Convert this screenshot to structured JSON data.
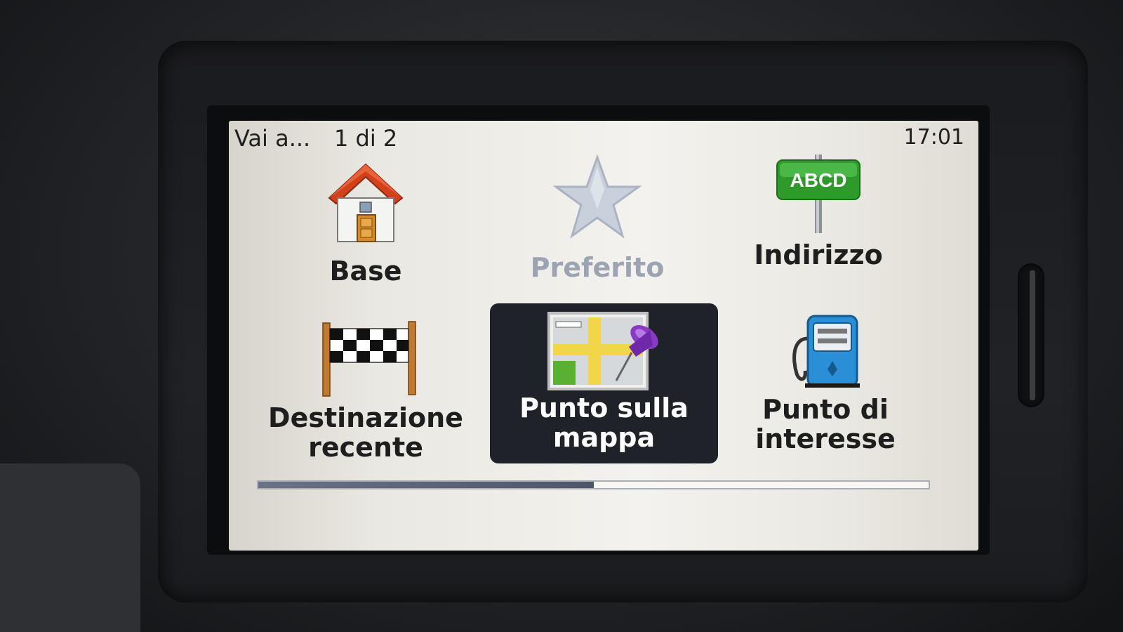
{
  "header": {
    "title": "Vai a...",
    "page_indicator": "1 di 2",
    "time": "17:01"
  },
  "menu": [
    {
      "label": "Base",
      "icon": "home-icon",
      "state": "normal"
    },
    {
      "label": "Preferito",
      "icon": "star-icon",
      "state": "disabled"
    },
    {
      "label": "Indirizzo",
      "icon": "street-sign-icon",
      "sign_text": "ABCD",
      "state": "normal"
    },
    {
      "label_line1": "Destinazione",
      "label_line2": "recente",
      "icon": "checkered-flag-icon",
      "state": "normal"
    },
    {
      "label_line1": "Punto sulla",
      "label_line2": "mappa",
      "icon": "map-pin-icon",
      "state": "selected"
    },
    {
      "label_line1": "Punto di",
      "label_line2": "interesse",
      "icon": "fuel-pump-icon",
      "state": "normal"
    }
  ],
  "scroll": {
    "fraction": 0.5
  },
  "colors": {
    "selected_tile": "#1f2329",
    "disabled_text": "#9ca4b4",
    "roof": "#d2411c",
    "sign_green": "#2e9a2a",
    "pump_blue": "#2a8fd6",
    "pin_purple": "#8a3bc4"
  }
}
